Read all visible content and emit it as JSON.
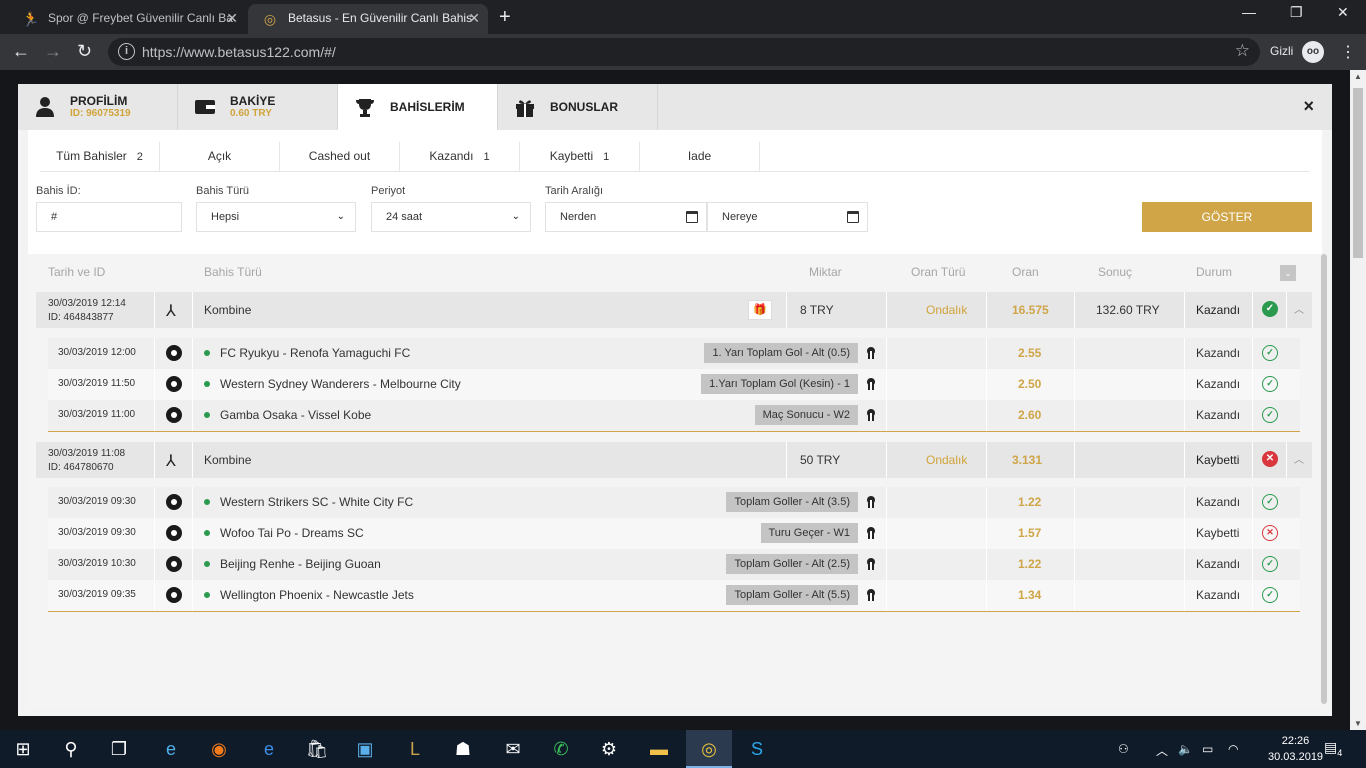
{
  "browser": {
    "tabs": [
      {
        "title": "Spor @ Freybet Güvenilir Canlı Ba"
      },
      {
        "title": "Betasus - En Güvenilir Canlı Bahis"
      }
    ],
    "url": "https://www.betasus122.com/#/",
    "incognito_label": "Gizli"
  },
  "modal": {
    "tabs": [
      {
        "title": "PROFİLİM",
        "sub": "ID: 96075319"
      },
      {
        "title": "BAKİYE",
        "sub": "0.60 TRY"
      },
      {
        "title": "BAHİSLERİM",
        "sub": ""
      },
      {
        "title": "BONUSLAR",
        "sub": ""
      }
    ],
    "close": "×"
  },
  "filters": {
    "tabs": [
      {
        "label": "Tüm Bahisler",
        "count": "2"
      },
      {
        "label": "Açık",
        "count": ""
      },
      {
        "label": "Cashed out",
        "count": ""
      },
      {
        "label": "Kazandı",
        "count": "1"
      },
      {
        "label": "Kaybetti",
        "count": "1"
      },
      {
        "label": "Iade",
        "count": ""
      }
    ],
    "bet_id_label": "Bahis İD:",
    "bet_id_value": "#",
    "bet_type_label": "Bahis Türü",
    "bet_type_value": "Hepsi",
    "period_label": "Periyot",
    "period_value": "24 saat",
    "date_range_label": "Tarih Aralığı",
    "from_value": "Nerden",
    "to_value": "Nereye",
    "show_button": "GÖSTER"
  },
  "table": {
    "headers": {
      "date_id": "Tarih ve ID",
      "bet_type": "Bahis Türü",
      "amount": "Miktar",
      "odds_type": "Oran Türü",
      "odds": "Oran",
      "result": "Sonuç",
      "status": "Durum"
    },
    "bets": [
      {
        "date": "30/03/2019 12:14",
        "id": "ID: 464843877",
        "type": "Kombine",
        "amount": "8  TRY",
        "odds_type": "Ondalık",
        "odds": "16.575",
        "result": "132.60 TRY",
        "status": "Kazandı",
        "won": true,
        "legs": [
          {
            "date": "30/03/2019 12:00",
            "match": "FC Ryukyu - Renofa Yamaguchi FC",
            "market": "1. Yarı Toplam Gol - Alt (0.5)",
            "odds": "2.55",
            "status": "Kazandı",
            "won": true
          },
          {
            "date": "30/03/2019 11:50",
            "match": "Western Sydney Wanderers - Melbourne City",
            "market": "1.Yarı Toplam Gol (Kesin) - 1",
            "odds": "2.50",
            "status": "Kazandı",
            "won": true
          },
          {
            "date": "30/03/2019 11:00",
            "match": "Gamba Osaka - Vissel Kobe",
            "market": "Maç Sonucu - W2",
            "odds": "2.60",
            "status": "Kazandı",
            "won": true
          }
        ]
      },
      {
        "date": "30/03/2019 11:08",
        "id": "ID: 464780670",
        "type": "Kombine",
        "amount": "50  TRY",
        "odds_type": "Ondalık",
        "odds": "3.131",
        "result": "",
        "status": "Kaybetti",
        "won": false,
        "legs": [
          {
            "date": "30/03/2019 09:30",
            "match": "Western Strikers SC - White City FC",
            "market": "Toplam Goller - Alt (3.5)",
            "odds": "1.22",
            "status": "Kazandı",
            "won": true
          },
          {
            "date": "30/03/2019 09:30",
            "match": "Wofoo Tai Po - Dreams SC",
            "market": "Turu Geçer - W1",
            "odds": "1.57",
            "status": "Kaybetti",
            "won": false
          },
          {
            "date": "30/03/2019 10:30",
            "match": "Beijing Renhe - Beijing Guoan",
            "market": "Toplam Goller - Alt (2.5)",
            "odds": "1.22",
            "status": "Kazandı",
            "won": true
          },
          {
            "date": "30/03/2019 09:35",
            "match": "Wellington Phoenix - Newcastle Jets",
            "market": "Toplam Goller - Alt (5.5)",
            "odds": "1.34",
            "status": "Kazandı",
            "won": true
          }
        ]
      }
    ]
  },
  "taskbar": {
    "time": "22:26",
    "date": "30.03.2019",
    "notifications": "4"
  },
  "colors": {
    "accent_gold": "#cfa548",
    "won_green": "#2b9a4f",
    "lost_red": "#d9363e"
  }
}
